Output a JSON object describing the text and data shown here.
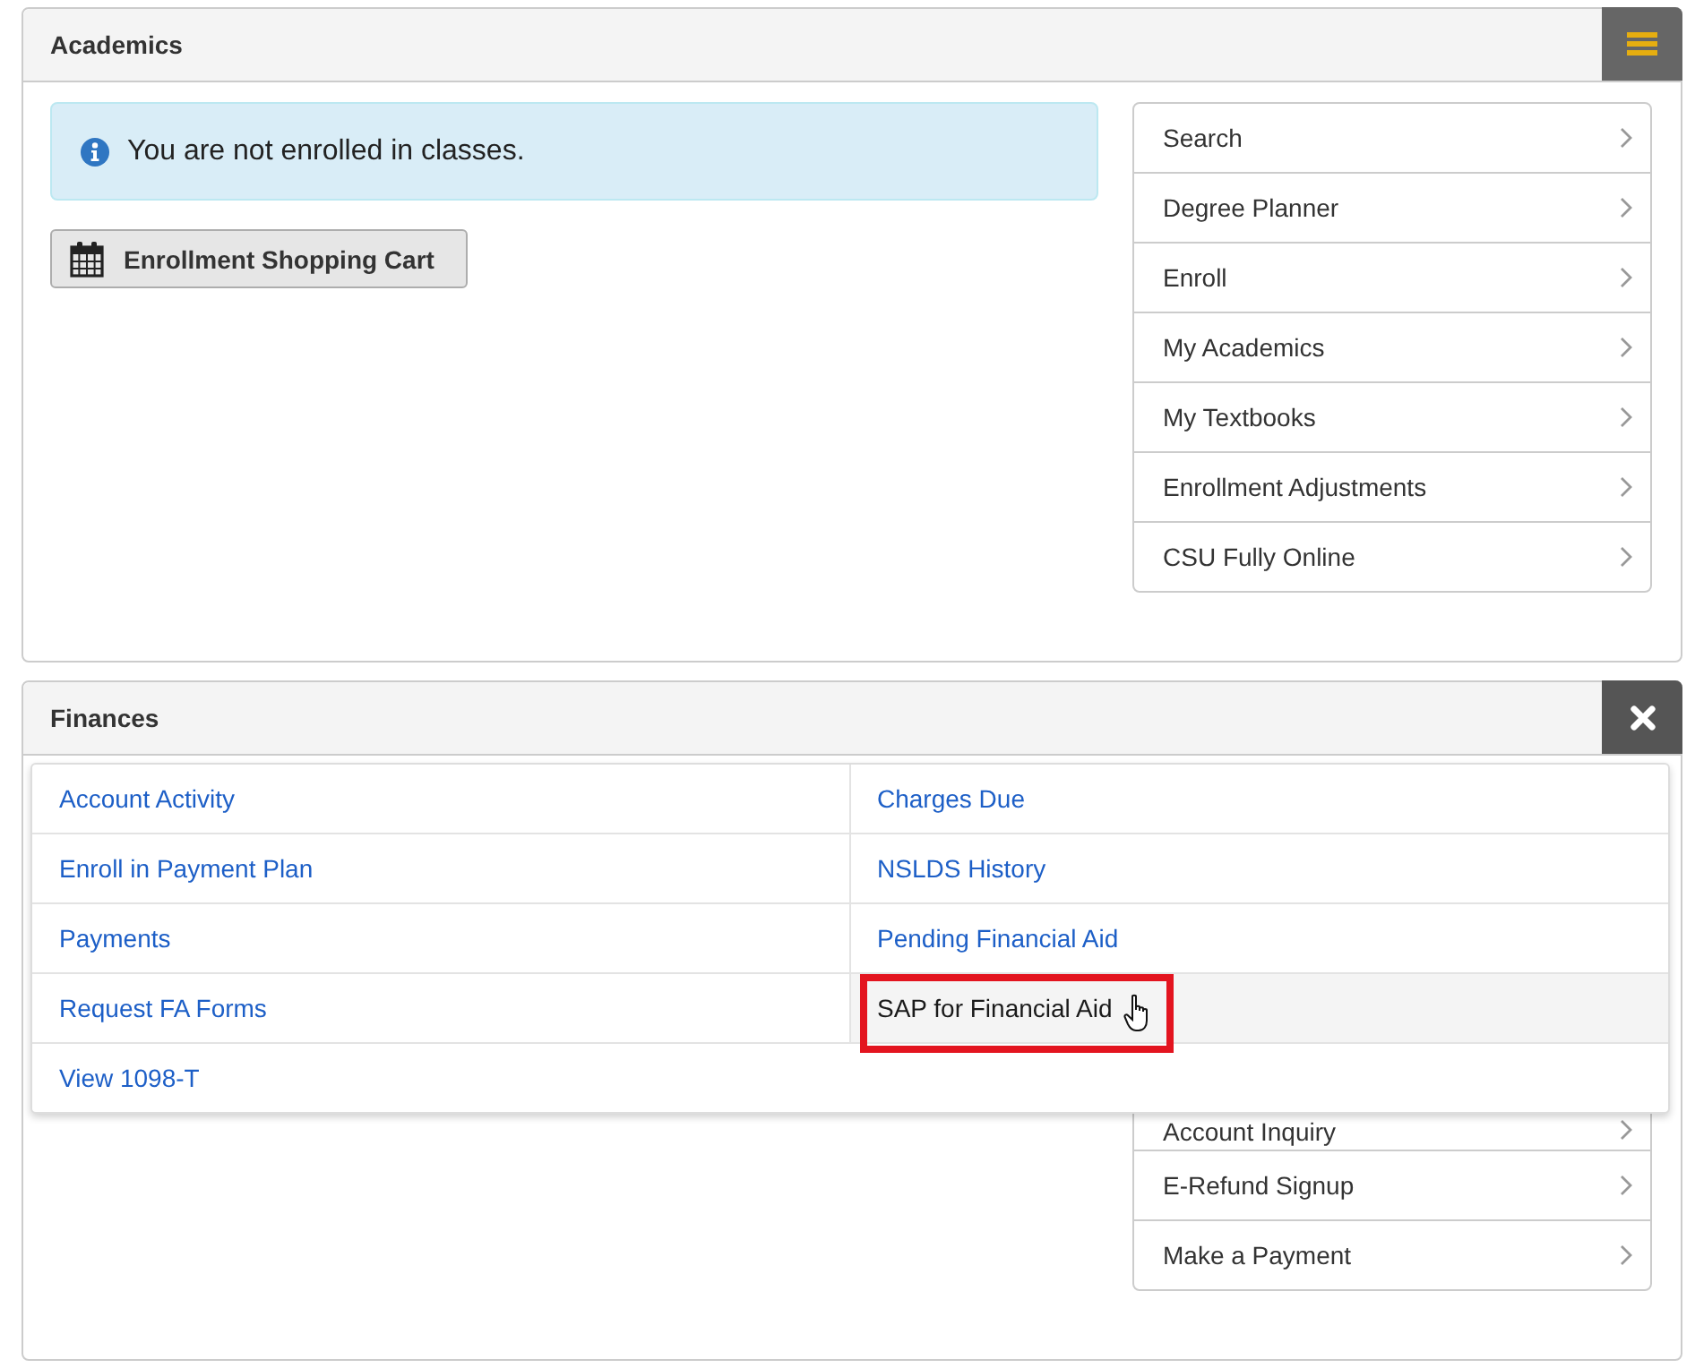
{
  "panels": [
    {
      "title": "Academics",
      "menu_open": false,
      "alert": {
        "text": "You are not enrolled in classes."
      },
      "button": {
        "label": "Enrollment Shopping Cart"
      },
      "links": [
        "Search",
        "Degree Planner",
        "Enroll",
        "My Academics",
        "My Textbooks",
        "Enrollment Adjustments",
        "CSU Fully Online"
      ]
    },
    {
      "title": "Finances",
      "menu_open": true,
      "menu": [
        {
          "label": "Account Activity",
          "hovered": false,
          "annotated": false
        },
        {
          "label": "Charges Due",
          "hovered": false,
          "annotated": false
        },
        {
          "label": "Enroll in Payment Plan",
          "hovered": false,
          "annotated": false
        },
        {
          "label": "NSLDS History",
          "hovered": false,
          "annotated": false
        },
        {
          "label": "Payments",
          "hovered": false,
          "annotated": false
        },
        {
          "label": "Pending Financial Aid",
          "hovered": false,
          "annotated": false
        },
        {
          "label": "Request FA Forms",
          "hovered": false,
          "annotated": false
        },
        {
          "label": "SAP for Financial Aid",
          "hovered": true,
          "annotated": true
        },
        {
          "label": "View 1098-T",
          "hovered": false,
          "annotated": false
        }
      ],
      "links": [
        "Account Inquiry",
        "E-Refund Signup",
        "Make a Payment"
      ]
    }
  ]
}
